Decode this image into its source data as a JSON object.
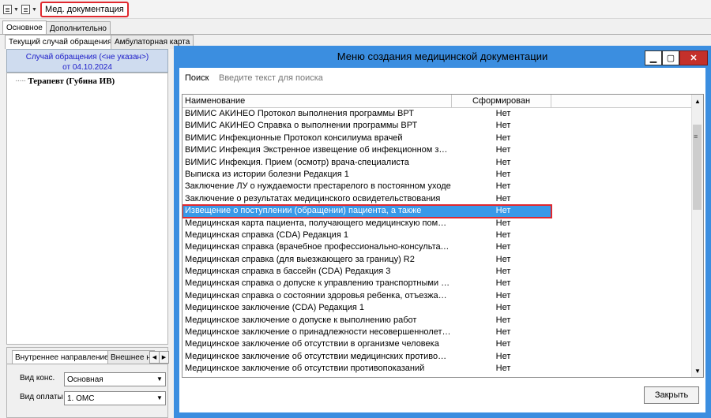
{
  "toolbar": {
    "icons": [
      "document-menu-icon",
      "tree-menu-icon"
    ],
    "med_doc_label": "Мед. документация"
  },
  "tabs": {
    "main": [
      "Основное",
      "Дополнительно"
    ],
    "sub": [
      "Текущий случай обращения",
      "Амбулаторная карта"
    ]
  },
  "left_panel": {
    "case_line1": "Случай обращения (<не указан>)",
    "case_line2": "от 04.10.2024",
    "tree_item": "Терапевт (Губина ИВ)",
    "bottom_tabs": [
      "Внутреннее направление",
      "Внешнее на"
    ],
    "visit_type_label": "Вид конс.",
    "visit_type_value": "Основная",
    "payment_label": "Вид оплаты",
    "payment_value": "1. ОМС"
  },
  "dialog": {
    "title": "Меню создания медицинской документации",
    "search_label": "Поиск",
    "search_placeholder": "Введите текст для поиска",
    "columns": [
      "Наименование",
      "Сформирован"
    ],
    "rows": [
      {
        "name": "ВИМИС АКИНЕО Протокол выполнения программы ВРТ",
        "status": "Нет"
      },
      {
        "name": "ВИМИС АКИНЕО Справка о выполнении программы ВРТ",
        "status": "Нет"
      },
      {
        "name": "ВИМИС Инфекционные Протокол консилиума врачей",
        "status": "Нет"
      },
      {
        "name": "ВИМИС Инфекция Экстренное извещение об инфекционном заболевании",
        "status": "Нет"
      },
      {
        "name": "ВИМИС Инфекция. Прием (осмотр) врача-специалиста",
        "status": "Нет"
      },
      {
        "name": "Выписка из истории болезни Редакция 1",
        "status": "Нет"
      },
      {
        "name": "Заключение ЛУ о нуждаемости престарелого в постоянном уходе",
        "status": "Нет"
      },
      {
        "name": "Заключение о результатах медицинского освидетельствования",
        "status": "Нет"
      },
      {
        "name": "Извещение о поступлении (обращении) пациента, а также",
        "status": "Нет"
      },
      {
        "name": "Медицинская карта пациента, получающего медицинскую помощь",
        "status": "Нет"
      },
      {
        "name": "Медицинская справка (CDA) Редакция 1",
        "status": "Нет"
      },
      {
        "name": "Медицинская справка (врачебное профессионально-консультативное заключение)",
        "status": "Нет"
      },
      {
        "name": "Медицинская справка (для выезжающего за границу) R2",
        "status": "Нет"
      },
      {
        "name": "Медицинская справка в бассейн (CDA) Редакция 3",
        "status": "Нет"
      },
      {
        "name": "Медицинская справка о допуске к управлению транспортными средствами",
        "status": "Нет"
      },
      {
        "name": "Медицинская справка о состоянии здоровья ребенка, отъезжающего",
        "status": "Нет"
      },
      {
        "name": "Медицинское заключение  (CDA) Редакция 1",
        "status": "Нет"
      },
      {
        "name": "Медицинское заключение о допуске к выполнению работ",
        "status": "Нет"
      },
      {
        "name": "Медицинское заключение о принадлежности несовершеннолетнего",
        "status": "Нет"
      },
      {
        "name": "Медицинское заключение об отсутствии в организме человека",
        "status": "Нет"
      },
      {
        "name": "Медицинское заключение об отсутствии медицинских противопоказаний",
        "status": "Нет"
      },
      {
        "name": "Медицинское заключение об отсутствии противопоказаний",
        "status": "Нет"
      }
    ],
    "selected_index": 8,
    "close_label": "Закрыть",
    "accent_color": "#3b8ee0",
    "highlight_color": "#e0282e"
  }
}
